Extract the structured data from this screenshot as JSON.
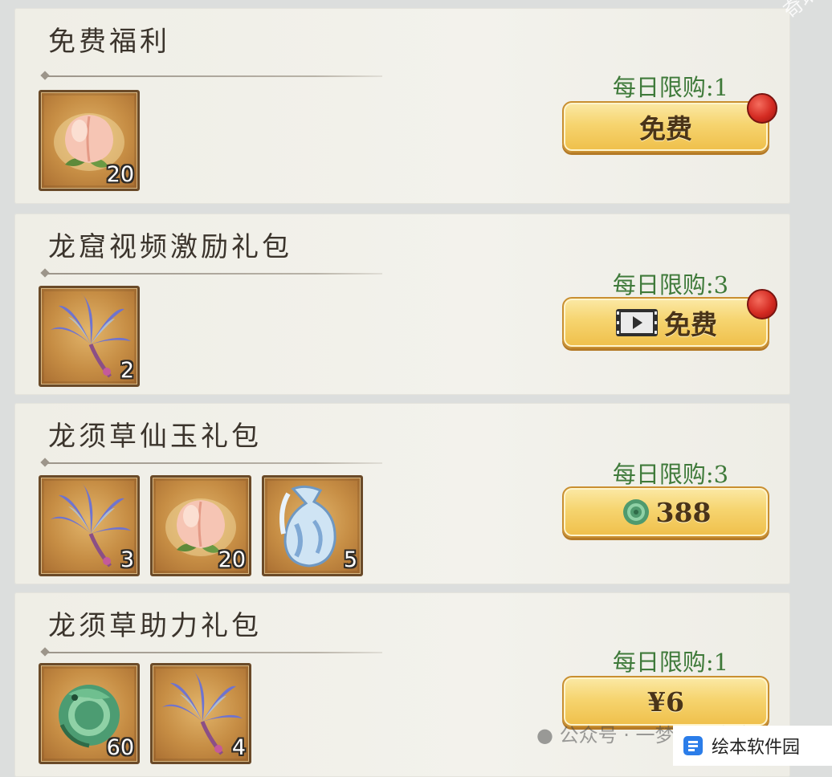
{
  "watermarks": {
    "top_right": "奇珀网",
    "bottom_channel": "公众号 · 一梦江湖攻略",
    "bottom_brand": "绘本软件园"
  },
  "packs": [
    {
      "title": "免费福利",
      "limit_text": "每日限购:1",
      "button_label": "免费",
      "button_icon": "none",
      "has_notification": true,
      "items": [
        {
          "icon": "peach-icon",
          "qty": "20"
        }
      ]
    },
    {
      "title": "龙窟视频激励礼包",
      "limit_text": "每日限购:3",
      "button_label": "免费",
      "button_icon": "video-icon",
      "has_notification": true,
      "items": [
        {
          "icon": "dragon-whisker-grass-icon",
          "qty": "2"
        }
      ]
    },
    {
      "title": "龙须草仙玉礼包",
      "limit_text": "每日限购:3",
      "button_label": "388",
      "button_icon": "jade-currency-icon",
      "has_notification": false,
      "items": [
        {
          "icon": "dragon-whisker-grass-icon",
          "qty": "3"
        },
        {
          "icon": "peach-icon",
          "qty": "20"
        },
        {
          "icon": "water-vase-icon",
          "qty": "5"
        }
      ]
    },
    {
      "title": "龙须草助力礼包",
      "limit_text": "每日限购:1",
      "button_label": "¥6",
      "button_icon": "none",
      "has_notification": false,
      "items": [
        {
          "icon": "jade-dragon-icon",
          "qty": "60"
        },
        {
          "icon": "dragon-whisker-grass-icon",
          "qty": "4"
        }
      ]
    }
  ]
}
